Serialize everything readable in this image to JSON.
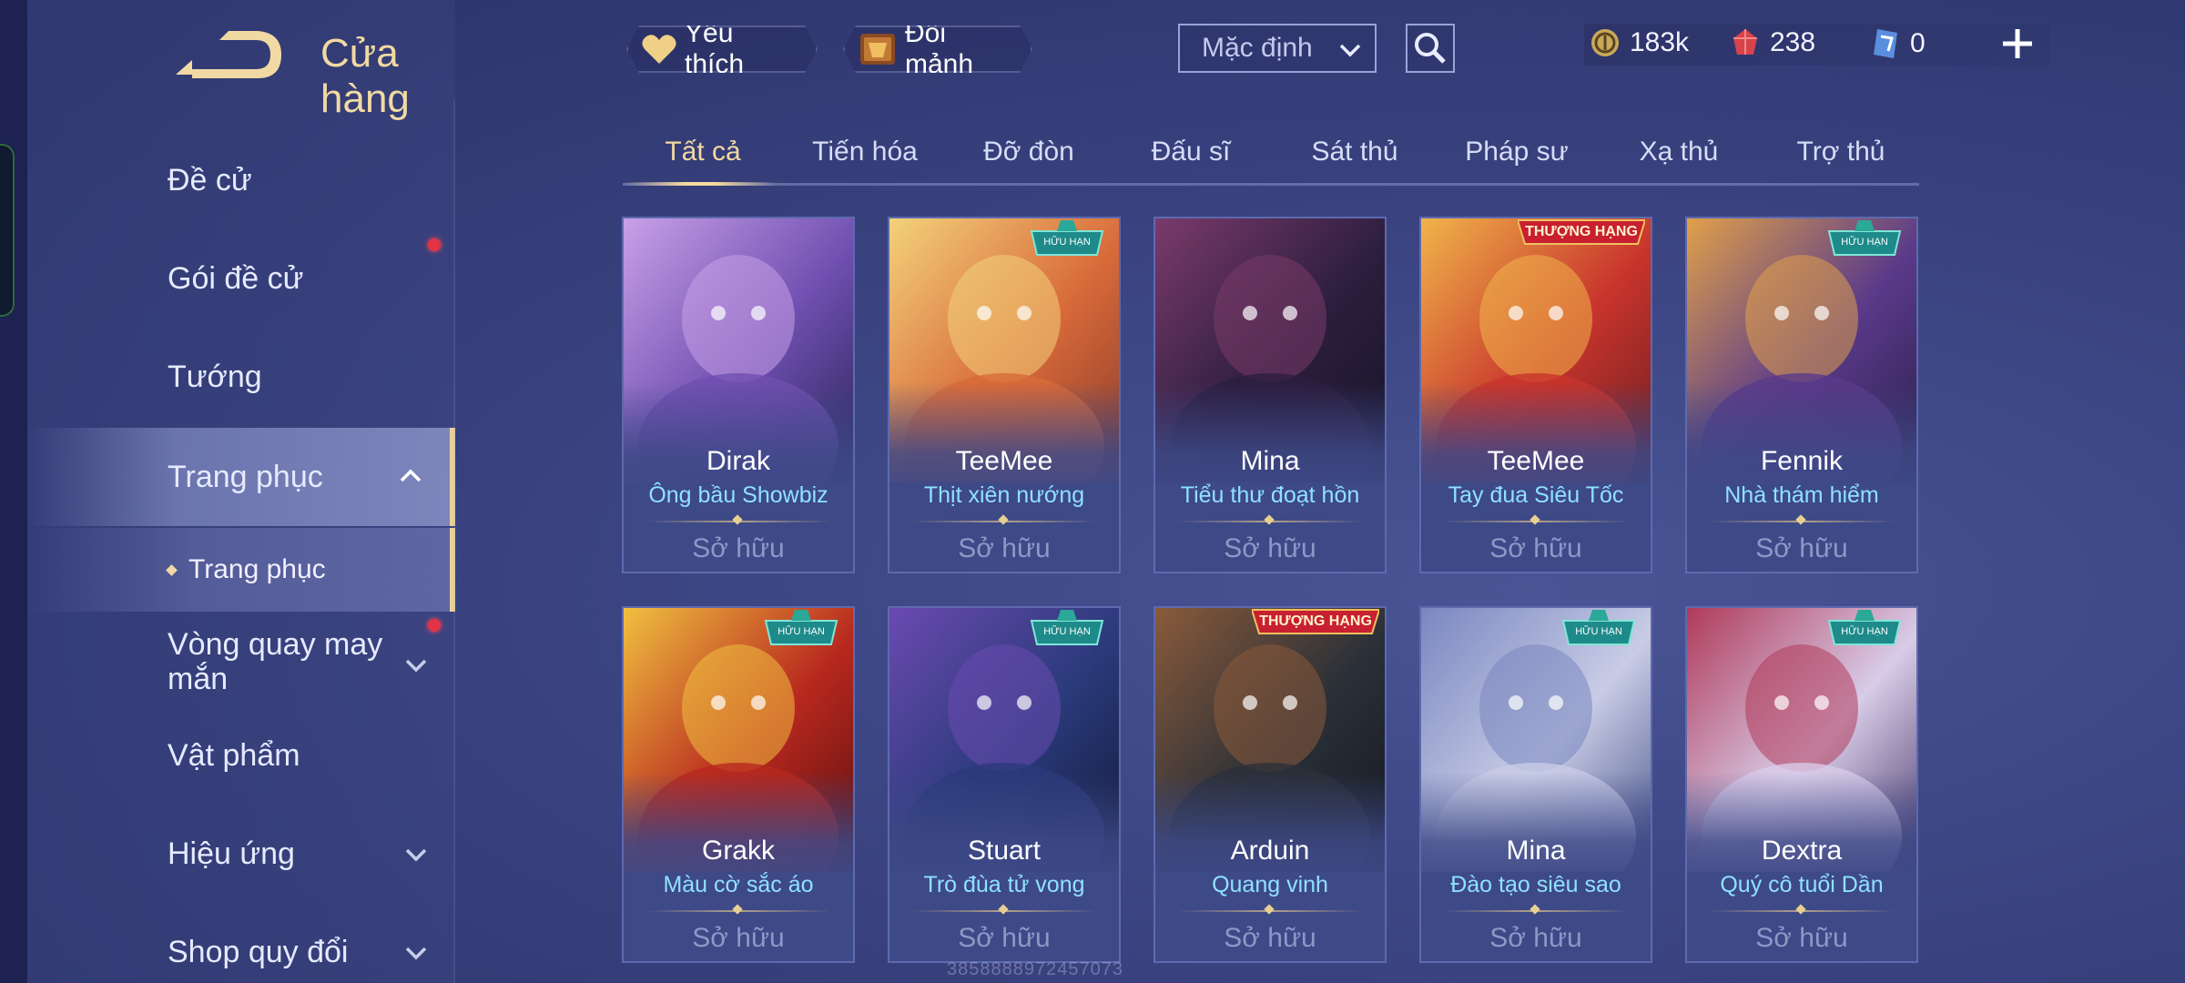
{
  "header": {
    "title": "Cửa hàng",
    "favorites_label": "Yêu thích",
    "exchange_label": "Đổi mảnh",
    "sort_value": "Mặc định"
  },
  "currency": {
    "gold": "183k",
    "vouchers": "238",
    "tickets": "0"
  },
  "sidebar": {
    "items": [
      {
        "label": "Đề cử"
      },
      {
        "label": "Gói đề cử"
      },
      {
        "label": "Tướng"
      },
      {
        "label": "Trang phục"
      },
      {
        "label": "Trang phục"
      },
      {
        "label": "Vòng quay may mắn"
      },
      {
        "label": "Vật phẩm"
      },
      {
        "label": "Hiệu ứng"
      },
      {
        "label": "Shop quy đổi"
      }
    ]
  },
  "tabs": [
    "Tất cả",
    "Tiến hóa",
    "Đỡ đòn",
    "Đấu sĩ",
    "Sát thủ",
    "Pháp sư",
    "Xạ thủ",
    "Trợ thủ"
  ],
  "cards": [
    {
      "hero": "Dirak",
      "skin": "Ông bầu Showbiz",
      "status": "Sở hữu",
      "badge": "",
      "colors": [
        "#6f4fb0",
        "#c8a0e8",
        "#2a2458"
      ]
    },
    {
      "hero": "TeeMee",
      "skin": "Thịt xiên nướng",
      "status": "Sở hữu",
      "badge": "HỮU HẠN",
      "colors": [
        "#d86a3a",
        "#f3d27a",
        "#8a3a2a"
      ]
    },
    {
      "hero": "Mina",
      "skin": "Tiểu thư đoạt hồn",
      "status": "Sở hữu",
      "badge": "",
      "colors": [
        "#2c1e3e",
        "#7a3a6a",
        "#151426"
      ]
    },
    {
      "hero": "TeeMee",
      "skin": "Tay đua Siêu Tốc",
      "status": "Sở hữu",
      "badge": "THƯỢNG HẠNG",
      "colors": [
        "#c8342c",
        "#f0b44a",
        "#6a1e22"
      ]
    },
    {
      "hero": "Fennik",
      "skin": "Nhà thám hiểm",
      "status": "Sở hữu",
      "badge": "HỮU HẠN",
      "colors": [
        "#5a3a8a",
        "#e0a04a",
        "#2a1e4a"
      ]
    },
    {
      "hero": "Grakk",
      "skin": "Màu cờ sắc áo",
      "status": "Sở hữu",
      "badge": "HỮU HẠN",
      "colors": [
        "#b8281e",
        "#f0c040",
        "#5a1010"
      ]
    },
    {
      "hero": "Stuart",
      "skin": "Trò đùa tử vong",
      "status": "Sở hữu",
      "badge": "HỮU HẠN",
      "colors": [
        "#2a3a7a",
        "#6a4ab0",
        "#121a3a"
      ]
    },
    {
      "hero": "Arduin",
      "skin": "Quang vinh",
      "status": "Sở hữu",
      "badge": "THƯỢNG HẠNG",
      "colors": [
        "#2a3038",
        "#8a5a3a",
        "#141820"
      ]
    },
    {
      "hero": "Mina",
      "skin": "Đào tạo siêu sao",
      "status": "Sở hữu",
      "badge": "HỮU HẠN",
      "colors": [
        "#c8cce6",
        "#7a86c0",
        "#4a5488"
      ]
    },
    {
      "hero": "Dextra",
      "skin": "Quý cô tuổi Dần",
      "status": "Sở hữu",
      "badge": "HỮU HẠN",
      "colors": [
        "#d8cce8",
        "#b03a5a",
        "#4a3a6a"
      ]
    }
  ],
  "watermark": "3858888972457073",
  "colors": {
    "accent_gold": "#f1d9a3",
    "skin_name": "#8fe1ff",
    "badge_red": "#c82030",
    "badge_teal": "#1e8a8a"
  }
}
